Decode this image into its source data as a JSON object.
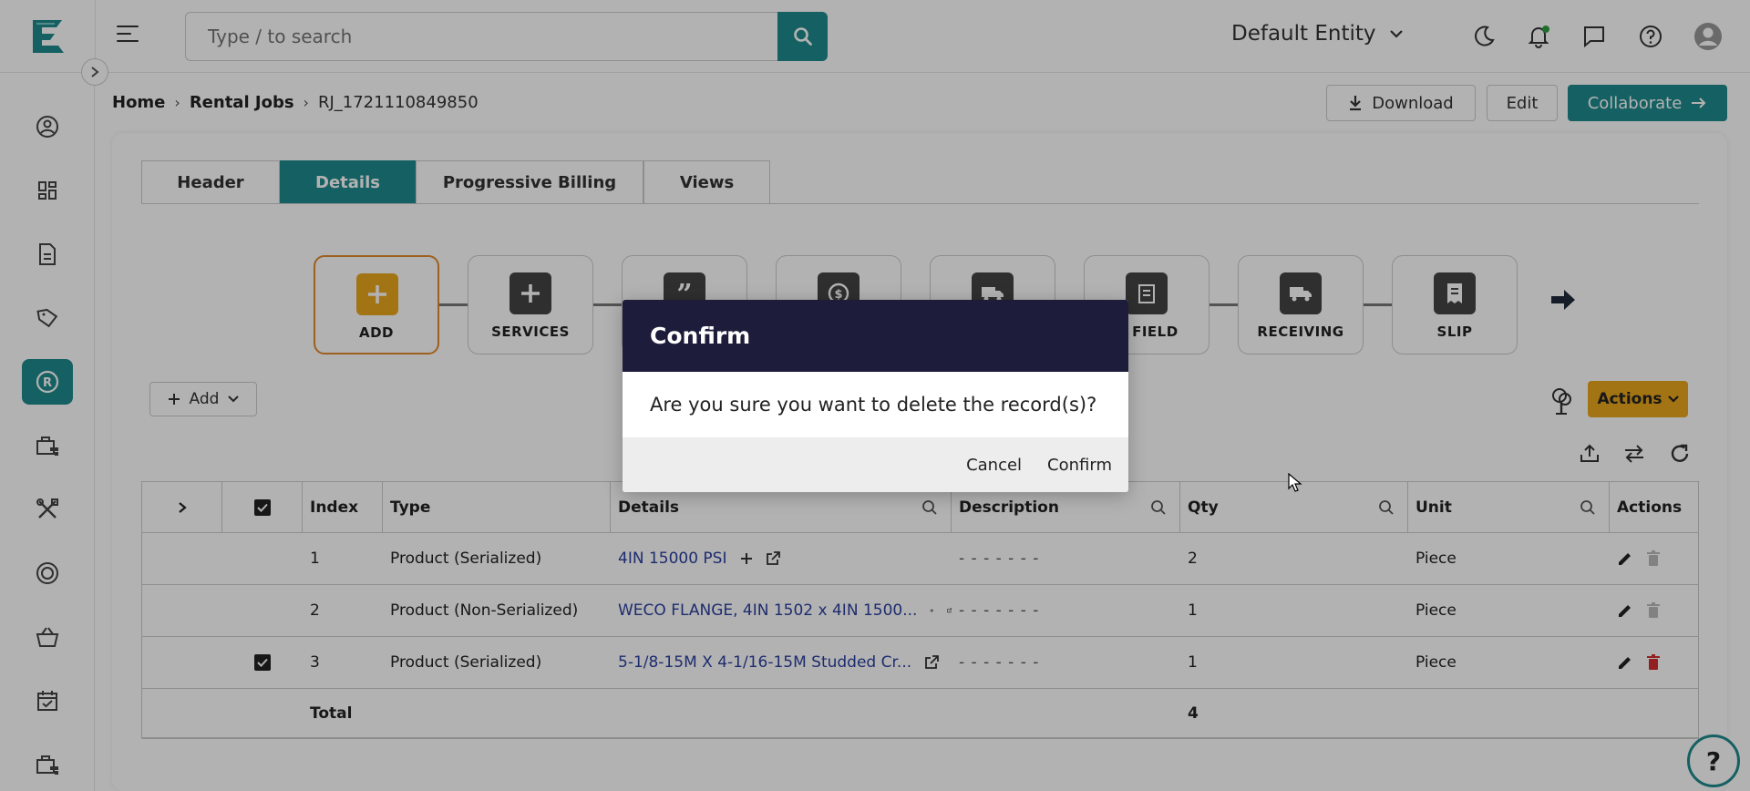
{
  "app": {
    "logo_letter": "E"
  },
  "search": {
    "placeholder": "Type / to search"
  },
  "entity": {
    "label": "Default Entity"
  },
  "breadcrumb": {
    "home": "Home",
    "section": "Rental Jobs",
    "current": "RJ_1721110849850"
  },
  "header_actions": {
    "download": "Download",
    "edit": "Edit",
    "collaborate": "Collaborate"
  },
  "tabs": [
    {
      "label": "Header"
    },
    {
      "label": "Details"
    },
    {
      "label": "Progressive Billing"
    },
    {
      "label": "Views"
    }
  ],
  "workflow": {
    "steps": [
      {
        "label": "ADD",
        "icon": "plus-icon"
      },
      {
        "label": "SERVICES",
        "icon": "plus-icon"
      },
      {
        "label": "",
        "icon": "quote-icon"
      },
      {
        "label": "",
        "icon": "dollar-icon"
      },
      {
        "label": "",
        "icon": "truck-icon"
      },
      {
        "label": "N FIELD",
        "icon": "field-icon"
      },
      {
        "label": "RECEIVING",
        "icon": "truck-icon"
      },
      {
        "label": "SLIP",
        "icon": "slip-icon"
      }
    ]
  },
  "toolbar": {
    "add_label": "Add",
    "actions_label": "Actions"
  },
  "grid": {
    "columns": {
      "index": "Index",
      "type": "Type",
      "details": "Details",
      "description": "Description",
      "qty": "Qty",
      "unit": "Unit",
      "actions": "Actions"
    },
    "rows": [
      {
        "index": "1",
        "type": "Product (Serialized)",
        "details": "4IN 15000 PSI",
        "description": "- - - - - - -",
        "qty": "2",
        "unit": "Piece",
        "checked": false
      },
      {
        "index": "2",
        "type": "Product (Non-Serialized)",
        "details": "WECO FLANGE, 4IN 1502 x 4IN 1500...",
        "description": "- - - - - - -",
        "qty": "1",
        "unit": "Piece",
        "checked": false
      },
      {
        "index": "3",
        "type": "Product (Serialized)",
        "details": "5-1/8-15M X 4-1/16-15M Studded Cr...",
        "description": "- - - - - - -",
        "qty": "1",
        "unit": "Piece",
        "checked": true
      }
    ],
    "total_label": "Total",
    "total_qty": "4"
  },
  "help": {
    "label": "?"
  },
  "dialog": {
    "title": "Confirm",
    "message": "Are you sure you want to delete the record(s)?",
    "cancel": "Cancel",
    "confirm": "Confirm"
  },
  "colors": {
    "accent": "#1f8a8d",
    "warning": "#e9a61d",
    "dialog_header": "#1d1c3a",
    "danger": "#d32f2f"
  }
}
